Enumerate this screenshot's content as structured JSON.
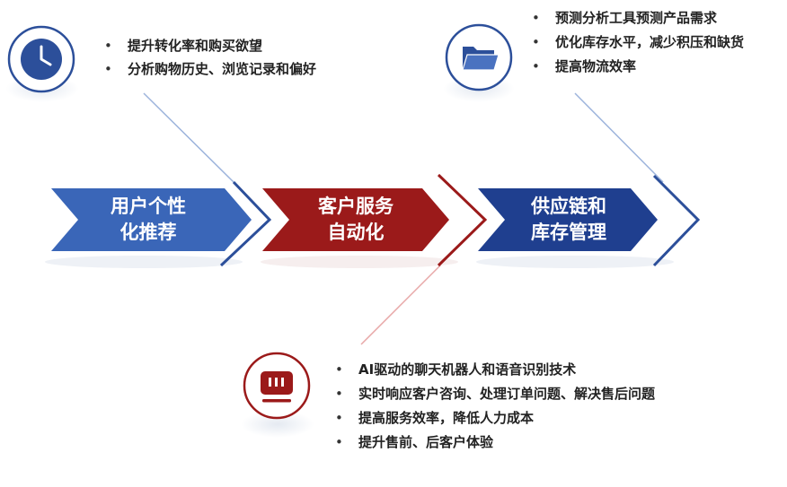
{
  "chevrons": [
    {
      "line1": "用户个性",
      "line2": "化推荐",
      "color": "#3a66b8"
    },
    {
      "line1": "客户服务",
      "line2": "自动化",
      "color": "#9b1a1a"
    },
    {
      "line1": "供应链和",
      "line2": "库存管理",
      "color": "#1f3f8f"
    }
  ],
  "recommendation_points": [
    "提升转化率和购买欲望",
    "分析购物历史、浏览记录和偏好"
  ],
  "supply_chain_points": [
    "预测分析工具预测产品需求",
    "优化库存水平，减少积压和缺货",
    "提高物流效率"
  ],
  "service_points": [
    "AI驱动的聊天机器人和语音识别技术",
    "实时响应客户咨询、处理订单问题、解决售后问题",
    "提高服务效率，降低人力成本",
    "提升售前、后客户体验"
  ],
  "icons": {
    "recommendation": "clock-icon",
    "supply_chain": "folder-icon",
    "service": "chatbot-icon"
  },
  "colors": {
    "blue": "#2c4f9a",
    "red": "#9b1a1a",
    "light_blue_line": "#9db4dc",
    "light_red_line": "#e8a8a8"
  }
}
